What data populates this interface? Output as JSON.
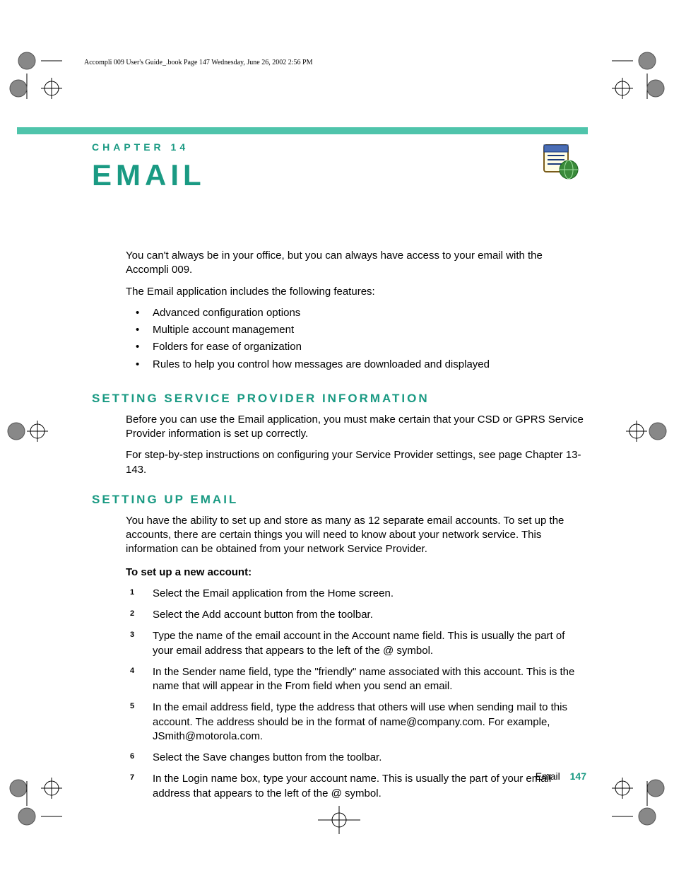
{
  "header_line": "Accompli 009 User's Guide_.book  Page 147  Wednesday, June 26, 2002  2:56 PM",
  "chapter_label": "CHAPTER 14",
  "chapter_title": "EMAIL",
  "intro_p1": "You can't always be in your office, but you can always have access to your email with the Accompli 009.",
  "intro_p2": "The Email application includes the following features:",
  "features": [
    "Advanced configuration options",
    "Multiple account management",
    "Folders for ease of organization",
    "Rules to help you control how messages are downloaded and displayed"
  ],
  "section1_head": "SETTING SERVICE PROVIDER INFORMATION",
  "section1_p1": "Before you can use the Email application, you must make certain that your CSD or GPRS Service Provider information is set up correctly.",
  "section1_p2": "For step-by-step instructions on configuring your Service Provider settings, see page Chapter 13-143.",
  "section2_head": "SETTING UP EMAIL",
  "section2_p1": "You have the ability to set up and store as many as 12 separate email accounts. To set up the accounts, there are certain things you will need to know about your network service. This information can be obtained from your network Service Provider.",
  "procedure_label": "To set up a new account:",
  "steps": [
    "Select the Email application from the Home screen.",
    "Select the Add account button from the toolbar.",
    "Type the name of the email account in the Account name field. This is usually the part of your email address that appears to the left of the @ symbol.",
    "In the Sender name field, type the \"friendly\" name associated with this account. This is the name that will appear in the From field when you send an email.",
    "In the email address field, type the address that others will use when sending mail to this account. The address should be in the format of name@company.com. For example, JSmith@motorola.com.",
    "Select the Save changes button from the toolbar.",
    "In the Login name box, type your account name. This is usually the part of your email address that appears to the left of the @ symbol."
  ],
  "footer_label": "Email",
  "footer_page": "147"
}
